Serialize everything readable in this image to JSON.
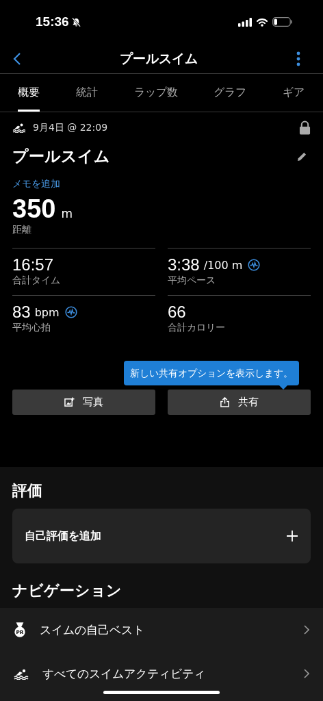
{
  "status_bar": {
    "time": "15:36",
    "silent": true
  },
  "header": {
    "title": "プールスイム"
  },
  "tabs": [
    {
      "label": "概要",
      "selected": true
    },
    {
      "label": "統計",
      "selected": false
    },
    {
      "label": "ラップ数",
      "selected": false
    },
    {
      "label": "グラフ",
      "selected": false
    },
    {
      "label": "ギア",
      "selected": false
    }
  ],
  "activity": {
    "date": "9月4日 @ 22:09",
    "locked": true,
    "title": "プールスイム",
    "add_note": "メモを追加",
    "distance": {
      "value": "350",
      "unit": "m",
      "label": "距離"
    }
  },
  "metrics": [
    {
      "value": "16:57",
      "label": "合計タイム",
      "chart_link": false
    },
    {
      "value": "3:38",
      "unit": "/100 m",
      "label": "平均ペース",
      "chart_link": true
    },
    {
      "value": "83",
      "unit": "bpm",
      "label": "平均心拍",
      "chart_link": true
    },
    {
      "value": "66",
      "label": "合計カロリー",
      "chart_link": false
    }
  ],
  "tooltip": "新しい共有オプションを表示します。",
  "buttons": [
    {
      "kind": "photo",
      "label": "写真"
    },
    {
      "kind": "share",
      "label": "共有"
    }
  ],
  "rating": {
    "heading": "評価",
    "add_label": "自己評価を追加"
  },
  "navigation": {
    "heading": "ナビゲーション",
    "items": [
      {
        "kind": "medal",
        "badge": "PR",
        "label": "スイムの自己ベスト"
      },
      {
        "kind": "swim",
        "label": "すべてのスイムアクティビティ"
      }
    ]
  }
}
